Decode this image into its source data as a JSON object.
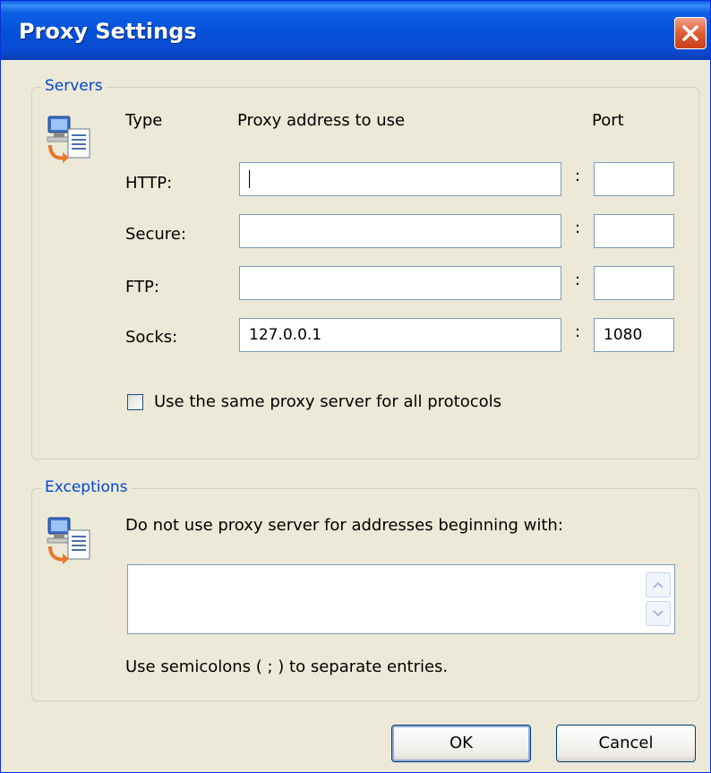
{
  "window": {
    "title": "Proxy Settings"
  },
  "servers": {
    "legend": "Servers",
    "icon": "network-computer-document-icon",
    "col_type": "Type",
    "col_address": "Proxy address to use",
    "col_port": "Port",
    "rows": [
      {
        "label": "HTTP:",
        "address": "",
        "port": "",
        "focused": true
      },
      {
        "label": "Secure:",
        "address": "",
        "port": ""
      },
      {
        "label": "FTP:",
        "address": "",
        "port": ""
      },
      {
        "label": "Socks:",
        "address": "127.0.0.1",
        "port": "1080"
      }
    ],
    "separator": ":",
    "same_proxy_label": "Use the same proxy server for all protocols",
    "same_proxy_checked": false
  },
  "exceptions": {
    "legend": "Exceptions",
    "icon": "network-computer-document-icon",
    "description": "Do not use proxy server for addresses beginning with:",
    "value": "",
    "hint": "Use semicolons ( ; ) to separate entries."
  },
  "buttons": {
    "ok": "OK",
    "cancel": "Cancel"
  },
  "colors": {
    "titlebar": "#0550d8",
    "legend": "#0046d5",
    "dialog_bg": "#ece9d8",
    "close": "#e05a34"
  }
}
